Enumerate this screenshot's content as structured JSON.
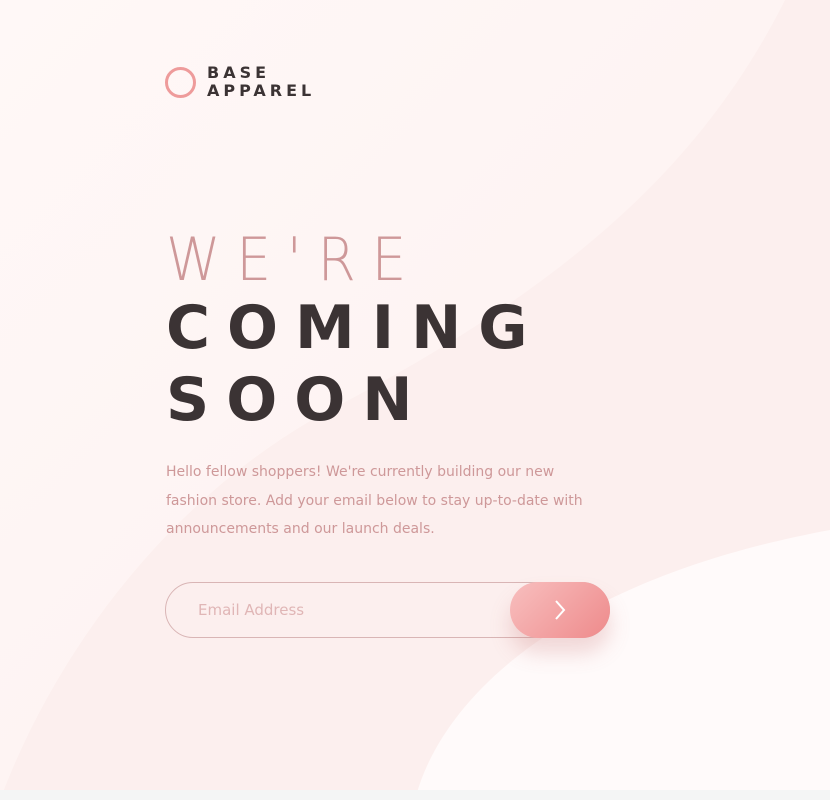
{
  "brand": {
    "line1": "BASE",
    "line2": "APPAREL",
    "ring_color": "#ee9b9b",
    "icon": "circle-logo-icon"
  },
  "headline": {
    "line1": "WE'RE",
    "line2": "COMING",
    "line3": "SOON"
  },
  "description": "Hello fellow shoppers! We're currently building our new fashion store. Add your email below to stay up-to-date with announcements and our launch deals.",
  "form": {
    "email_placeholder": "Email Address",
    "email_value": "",
    "submit_icon": "chevron-right-icon"
  },
  "colors": {
    "accent": "#ee8a8b",
    "text_dark": "#3b3334",
    "text_pink": "#ce9899",
    "background": "#fdf2f1"
  }
}
